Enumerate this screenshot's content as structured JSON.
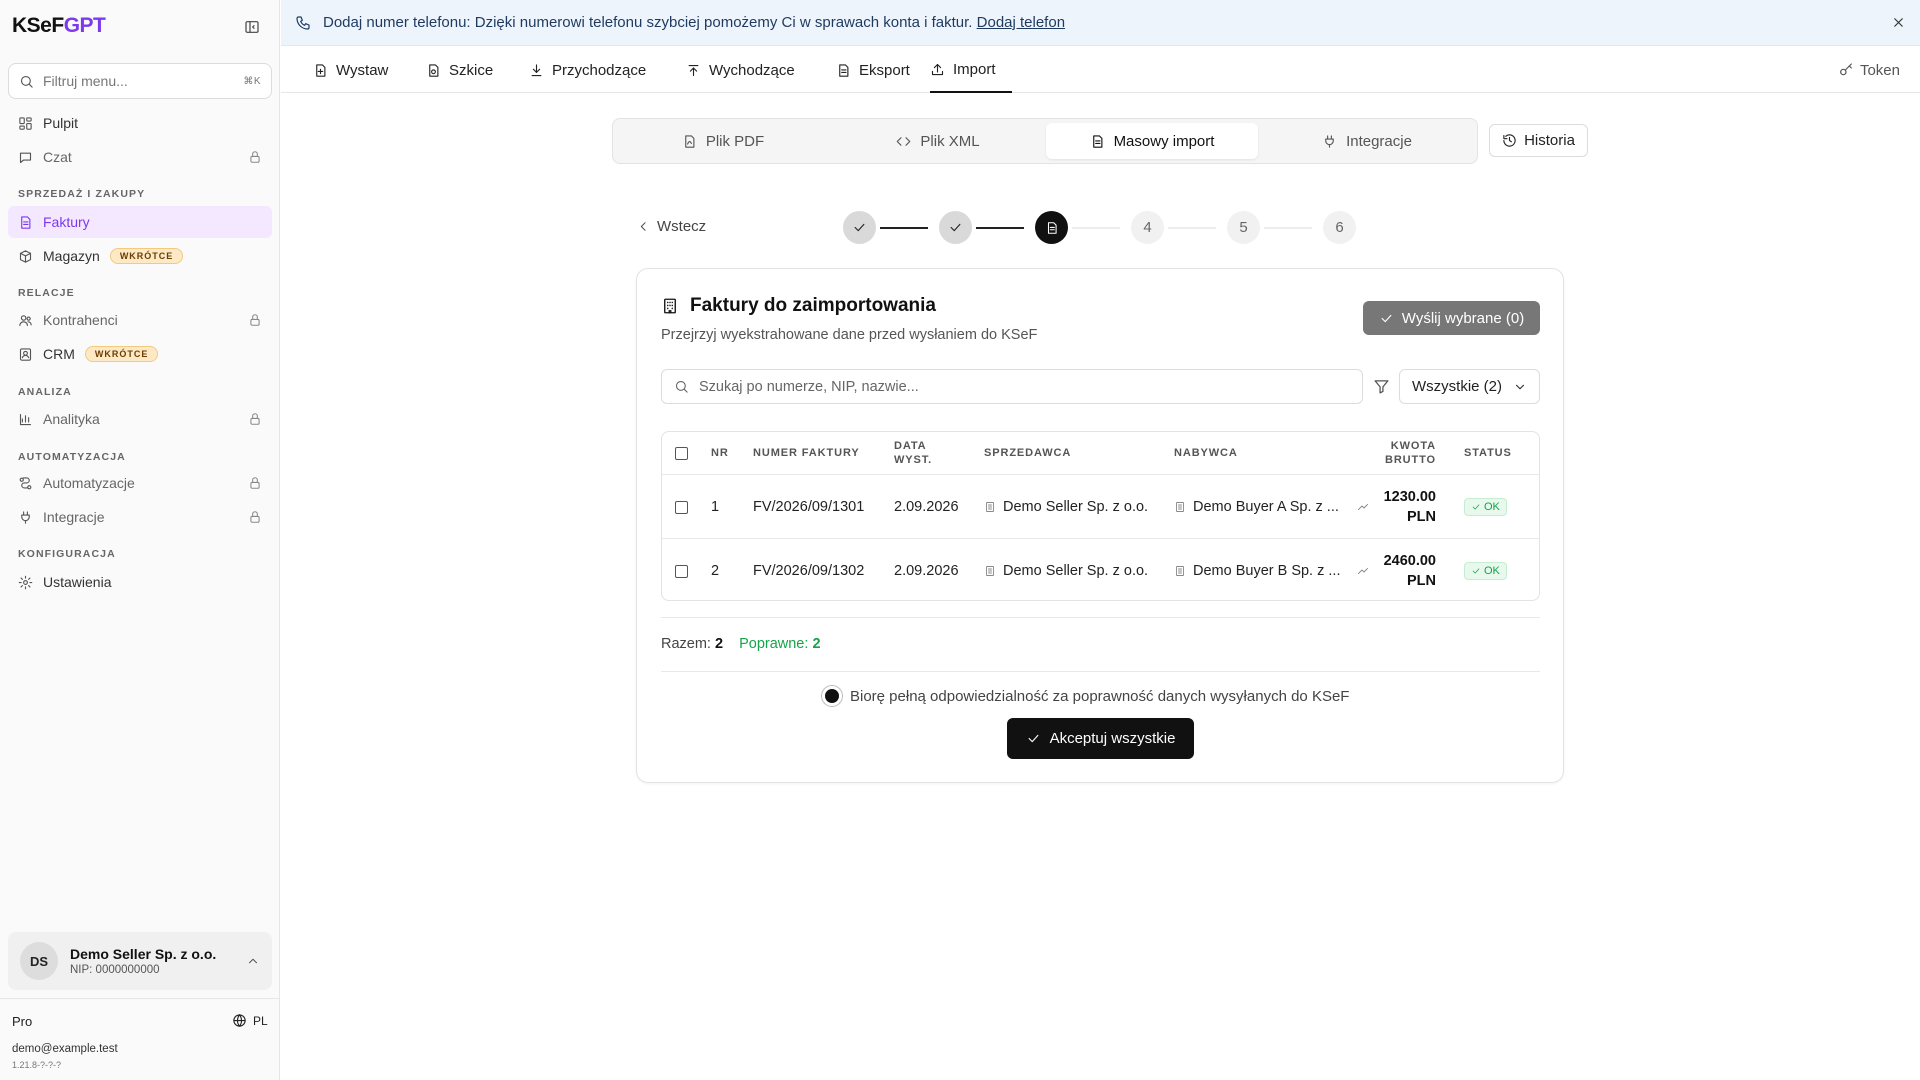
{
  "app": {
    "logo_main": "KSeF",
    "logo_accent": "GPT"
  },
  "sidebar": {
    "filter_placeholder": "Filtruj menu...",
    "filter_shortcut": "⌘K",
    "items": {
      "pulpit": "Pulpit",
      "czat": "Czat",
      "faktury": "Faktury",
      "magazyn": "Magazyn",
      "kontrahenci": "Kontrahenci",
      "crm": "CRM",
      "analityka": "Analityka",
      "automatyzacje": "Automatyzacje",
      "integracje": "Integracje",
      "ustawienia": "Ustawienia"
    },
    "badge_soon": "WKRÓTCE",
    "sections": {
      "sales": "SPRZEDAŻ I ZAKUPY",
      "relations": "RELACJE",
      "analysis": "ANALIZA",
      "automation": "AUTOMATYZACJA",
      "config": "KONFIGURACJA"
    },
    "account": {
      "initials": "DS",
      "name": "Demo Seller Sp. z o.o.",
      "nip": "NIP: 0000000000"
    },
    "plan": "Pro",
    "lang": "PL",
    "email": "demo@example.test",
    "version": "1.21.8-?-?-?"
  },
  "banner": {
    "text": "Dodaj numer telefonu: Dzięki numerowi telefonu szybciej pomożemy Ci w sprawach konta i faktur.",
    "link": "Dodaj telefon"
  },
  "topnav": {
    "wystaw": "Wystaw",
    "szkice": "Szkice",
    "przychodzace": "Przychodzące",
    "wychodzace": "Wychodzące",
    "eksport": "Eksport",
    "import": "Import",
    "token": "Token"
  },
  "source_tabs": {
    "pdf": "Plik PDF",
    "xml": "Plik XML",
    "mass": "Masowy import",
    "integrations": "Integracje",
    "history": "Historia"
  },
  "stepper": {
    "back": "Wstecz",
    "steps": [
      "1",
      "2",
      "3",
      "4",
      "5",
      "6"
    ],
    "current_step": 3
  },
  "card": {
    "title": "Faktury do zaimportowania",
    "subtitle": "Przejrzyj wyekstrahowane dane przed wysłaniem do KSeF",
    "send_button": "Wyślij wybrane (0)",
    "search_placeholder": "Szukaj po numerze, NIP, nazwie...",
    "filter_select": "Wszystkie (2)",
    "columns": {
      "nr": "NR",
      "number": "NUMER FAKTURY",
      "date_1": "DATA",
      "date_2": "WYST.",
      "seller": "SPRZEDAWCA",
      "buyer": "NABYWCA",
      "amount_1": "KWOTA",
      "amount_2": "BRUTTO",
      "status": "STATUS"
    },
    "rows": [
      {
        "nr": "1",
        "number": "FV/2026/09/1301",
        "date": "2.09.2026",
        "seller": "Demo Seller Sp. z o.o.",
        "buyer": "Demo Buyer A Sp. z ...",
        "amount": "1230.00",
        "currency": "PLN",
        "status": "OK"
      },
      {
        "nr": "2",
        "number": "FV/2026/09/1302",
        "date": "2.09.2026",
        "seller": "Demo Seller Sp. z o.o.",
        "buyer": "Demo Buyer B Sp. z ...",
        "amount": "2460.00",
        "currency": "PLN",
        "status": "OK"
      }
    ],
    "totals": {
      "total_label": "Razem:",
      "total_value": "2",
      "valid_label": "Poprawne:",
      "valid_value": "2"
    },
    "confirm_text": "Biorę pełną odpowiedzialność za poprawność danych wysyłanych do KSeF",
    "accept_button": "Akceptuj wszystkie"
  },
  "colors": {
    "accent": "#7c3aed",
    "ok": "#16a34a",
    "banner_bg": "#eef4fc"
  }
}
